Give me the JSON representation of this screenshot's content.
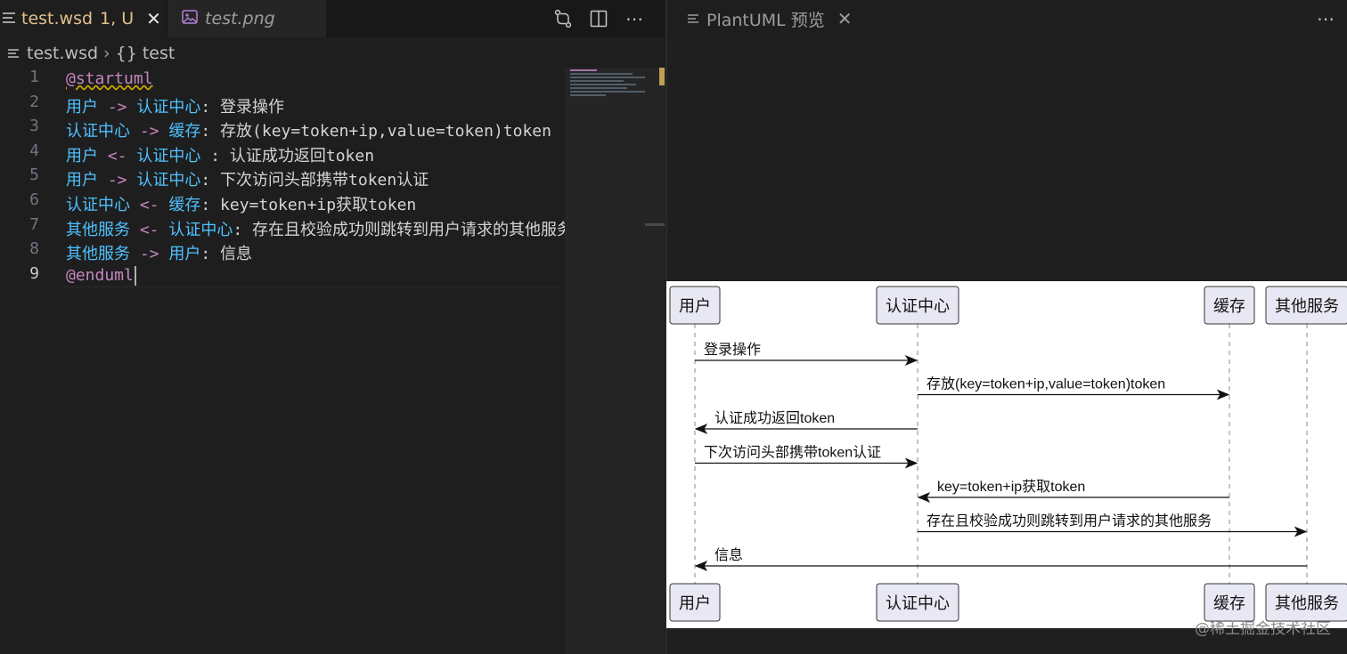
{
  "editor": {
    "active_tab": {
      "filename": "test.wsd",
      "status": "1, U"
    },
    "inactive_tab": {
      "filename": "test.png"
    },
    "breadcrumb": {
      "file": "test.wsd",
      "symbol_glyph": "{}",
      "symbol": "test"
    },
    "lines": [
      {
        "n": "1",
        "tokens": [
          {
            "t": "@startuml",
            "k": "kw-squiggle"
          }
        ]
      },
      {
        "n": "2",
        "tokens": [
          {
            "t": "用户",
            "k": "part"
          },
          {
            "t": " -> ",
            "k": "arrow"
          },
          {
            "t": "认证中心",
            "k": "part"
          },
          {
            "t": ": 登录操作",
            "k": "text"
          }
        ]
      },
      {
        "n": "3",
        "tokens": [
          {
            "t": "认证中心",
            "k": "part"
          },
          {
            "t": " -> ",
            "k": "arrow"
          },
          {
            "t": "缓存",
            "k": "part"
          },
          {
            "t": ": 存放(key=token+ip,value=token)token",
            "k": "text"
          }
        ]
      },
      {
        "n": "4",
        "tokens": [
          {
            "t": "用户",
            "k": "part"
          },
          {
            "t": " <- ",
            "k": "arrow"
          },
          {
            "t": "认证中心",
            "k": "part"
          },
          {
            "t": " : 认证成功返回token",
            "k": "text"
          }
        ]
      },
      {
        "n": "5",
        "tokens": [
          {
            "t": "用户",
            "k": "part"
          },
          {
            "t": " -> ",
            "k": "arrow"
          },
          {
            "t": "认证中心",
            "k": "part"
          },
          {
            "t": ": 下次访问头部携带token认证",
            "k": "text"
          }
        ]
      },
      {
        "n": "6",
        "tokens": [
          {
            "t": "认证中心",
            "k": "part"
          },
          {
            "t": " <- ",
            "k": "arrow"
          },
          {
            "t": "缓存",
            "k": "part"
          },
          {
            "t": ": key=token+ip获取token",
            "k": "text"
          }
        ]
      },
      {
        "n": "7",
        "tokens": [
          {
            "t": "其他服务",
            "k": "part"
          },
          {
            "t": " <- ",
            "k": "arrow"
          },
          {
            "t": "认证中心",
            "k": "part"
          },
          {
            "t": ": 存在且校验成功则跳转到用户请求的其他服务",
            "k": "text"
          }
        ]
      },
      {
        "n": "8",
        "tokens": [
          {
            "t": "其他服务",
            "k": "part"
          },
          {
            "t": " -> ",
            "k": "arrow"
          },
          {
            "t": "用户",
            "k": "part"
          },
          {
            "t": ": 信息",
            "k": "text"
          }
        ]
      },
      {
        "n": "9",
        "tokens": [
          {
            "t": "@enduml",
            "k": "kw-cursor"
          }
        ]
      }
    ]
  },
  "preview": {
    "tab_title": "PlantUML 预览",
    "participants": [
      "用户",
      "认证中心",
      "缓存",
      "其他服务"
    ],
    "messages": [
      {
        "from": 0,
        "to": 1,
        "label": "登录操作"
      },
      {
        "from": 1,
        "to": 2,
        "label": "存放(key=token+ip,value=token)token"
      },
      {
        "from": 1,
        "to": 0,
        "label": "认证成功返回token"
      },
      {
        "from": 0,
        "to": 1,
        "label": "下次访问头部携带token认证"
      },
      {
        "from": 2,
        "to": 1,
        "label": "key=token+ip获取token"
      },
      {
        "from": 1,
        "to": 3,
        "label": "存在且校验成功则跳转到用户请求的其他服务"
      },
      {
        "from": 3,
        "to": 0,
        "label": "信息"
      }
    ],
    "watermark": "@稀土掘金技术社区"
  },
  "colors": {
    "tab_modified": "#e2c08d",
    "keyword": "#c586c0",
    "participant": "#4fc1ff",
    "participant_fill": "#e8e8f5"
  },
  "icons": [
    "menu-lines-icon",
    "image-file-icon",
    "close-icon",
    "source-control-icon",
    "split-editor-icon",
    "more-actions-icon",
    "chevron-right-icon",
    "braces-icon"
  ]
}
